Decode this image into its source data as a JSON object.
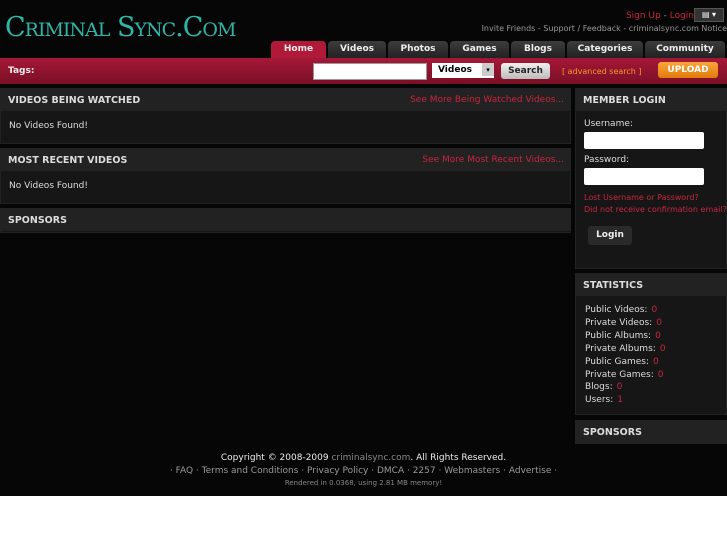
{
  "header": {
    "logo": "Criminal Sync.Com",
    "sign_up": "Sign Up",
    "login": "Login",
    "sep": " - ",
    "flag_icon": "us-flag-icon",
    "sublinks": "Invite Friends - Support / Feedback - criminalsync.com Notice"
  },
  "tabs": [
    "Home",
    "Videos",
    "Photos",
    "Games",
    "Blogs",
    "Categories",
    "Community"
  ],
  "search": {
    "tags_label": "Tags:",
    "type": "Videos",
    "button": "Search",
    "advanced": "[ advanced search ]",
    "upload": "UPLOAD"
  },
  "main": {
    "watched": {
      "title": "VIDEOS BEING WATCHED",
      "more": "See More Being Watched Videos...",
      "empty": "No Videos Found!"
    },
    "recent": {
      "title": "MOST RECENT VIDEOS",
      "more": "See More Most Recent Videos...",
      "empty": "No Videos Found!"
    },
    "sponsors": "SPONSORS"
  },
  "login": {
    "title": "MEMBER LOGIN",
    "username": "Username:",
    "password": "Password:",
    "lost": "Lost Username or Password?",
    "confirm": "Did not receive confirmation email?",
    "button": "Login"
  },
  "stats": {
    "title": "STATISTICS",
    "items": [
      {
        "label": "Public Videos:",
        "value": "0"
      },
      {
        "label": "Private Videos:",
        "value": "0"
      },
      {
        "label": "Public Albums:",
        "value": "0"
      },
      {
        "label": "Private Albums:",
        "value": "0"
      },
      {
        "label": "Public Games:",
        "value": "0"
      },
      {
        "label": "Private Games:",
        "value": "0"
      },
      {
        "label": "Blogs:",
        "value": "0"
      },
      {
        "label": "Users:",
        "value": "1"
      }
    ]
  },
  "side_sponsors": "SPONSORS",
  "footer": {
    "copy_pre": "Copyright © 2008-2009 ",
    "site": "criminalsync.com",
    "copy_post": ". All Rights Reserved.",
    "links": [
      "FAQ",
      "Terms and Conditions",
      "Privacy Policy",
      "DMCA",
      "2257",
      "Webmasters",
      "Advertise"
    ],
    "rendered": "Rendered in 0.0368, using 2.81 MB memory!"
  }
}
